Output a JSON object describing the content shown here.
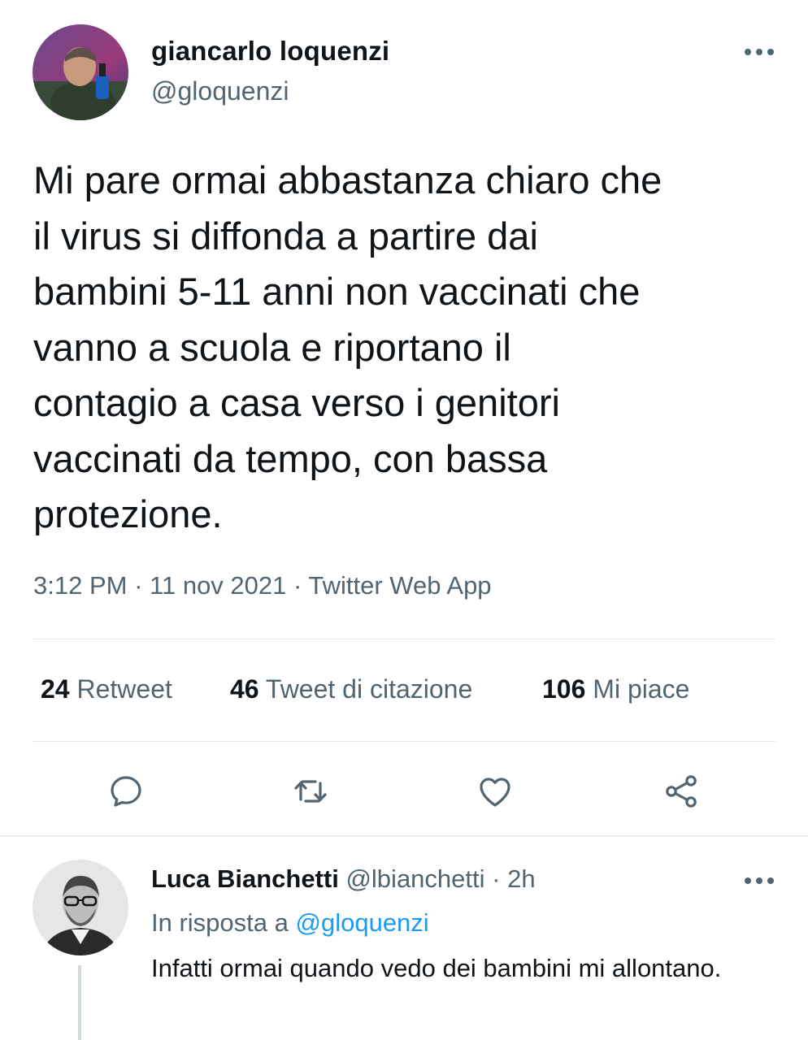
{
  "tweet": {
    "author": {
      "name": "giancarlo loquenzi",
      "handle": "@gloquenzi"
    },
    "text": "Mi pare ormai abbastanza chiaro che\nil virus si diffonda a partire dai\nbambini 5-11 anni non vaccinati che\nvanno a scuola e riportano il\ncontagio a casa verso i genitori\nvaccinati da tempo, con bassa\nprotezione.",
    "time": "3:12 PM",
    "date": "11 nov 2021",
    "source": "Twitter Web App",
    "separator": "·",
    "stats": {
      "retweets": {
        "count": "24",
        "label": "Retweet"
      },
      "quotes": {
        "count": "46",
        "label": "Tweet di citazione"
      },
      "likes": {
        "count": "106",
        "label": "Mi piace"
      }
    },
    "actions": [
      "reply-icon",
      "retweet-icon",
      "like-icon",
      "share-icon"
    ]
  },
  "reply": {
    "name": "Luca Bianchetti",
    "handle": "@lbianchetti",
    "time": "2h",
    "separator": "·",
    "reply_prefix": "In risposta a",
    "reply_to": "@gloquenzi",
    "text": "Infatti ormai quando vedo dei bambini mi allontano."
  },
  "colors": {
    "text": "#0f1419",
    "secondary": "#536471",
    "link": "#1d9bf0",
    "divider": "#e4e8eb"
  }
}
